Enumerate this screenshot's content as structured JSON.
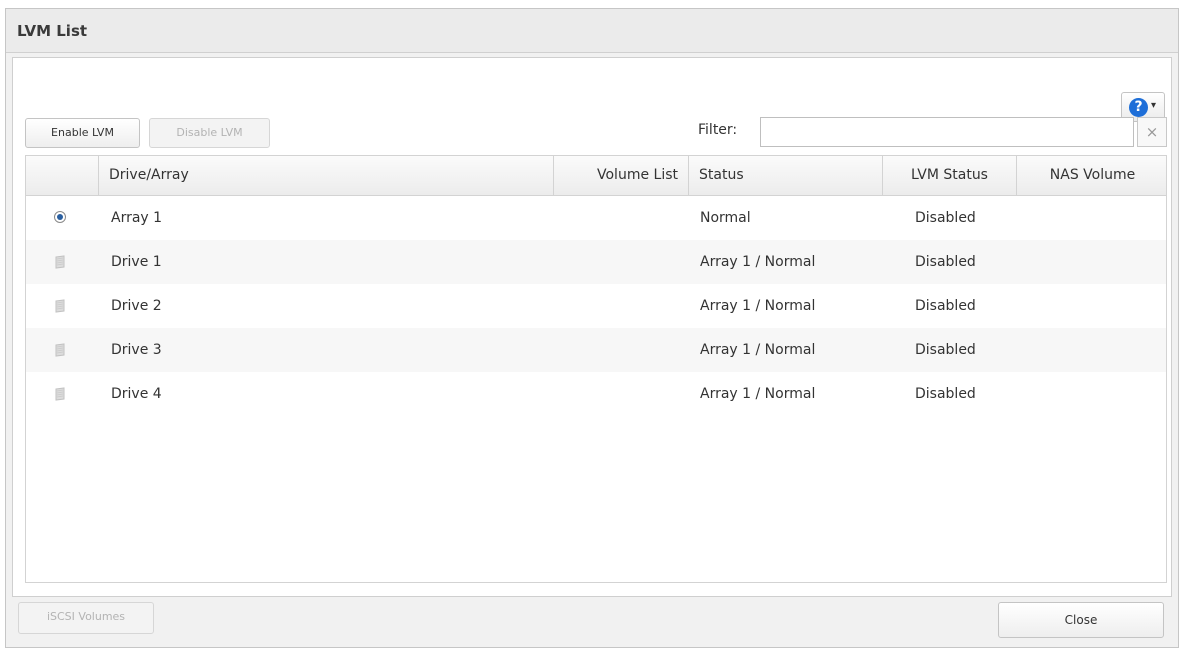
{
  "dialog": {
    "title": "LVM List"
  },
  "toolbar": {
    "enable_lvm_label": "Enable LVM",
    "disable_lvm_label": "Disable LVM",
    "help_symbol": "?",
    "help_caret": "▾",
    "help_icon": "help-circle-icon"
  },
  "filter": {
    "label": "Filter:",
    "value": "",
    "placeholder": "",
    "clear_symbol": "×"
  },
  "table": {
    "columns": [
      "",
      "Drive/Array",
      "Volume List",
      "Status",
      "LVM Status",
      "NAS Volume"
    ],
    "rows": [
      {
        "type": "array",
        "selected": true,
        "name": "Array 1",
        "volume_list": "",
        "status": "Normal",
        "lvm_status": "Disabled",
        "nas_volume": ""
      },
      {
        "type": "drive",
        "selected": false,
        "name": "Drive 1",
        "volume_list": "",
        "status": "Array 1 / Normal",
        "lvm_status": "Disabled",
        "nas_volume": ""
      },
      {
        "type": "drive",
        "selected": false,
        "name": "Drive 2",
        "volume_list": "",
        "status": "Array 1 / Normal",
        "lvm_status": "Disabled",
        "nas_volume": ""
      },
      {
        "type": "drive",
        "selected": false,
        "name": "Drive 3",
        "volume_list": "",
        "status": "Array 1 / Normal",
        "lvm_status": "Disabled",
        "nas_volume": ""
      },
      {
        "type": "drive",
        "selected": false,
        "name": "Drive 4",
        "volume_list": "",
        "status": "Array 1 / Normal",
        "lvm_status": "Disabled",
        "nas_volume": ""
      }
    ]
  },
  "footer": {
    "iscsi_volumes_label": "iSCSI Volumes",
    "close_label": "Close"
  },
  "colors": {
    "help_icon": "#1d6ed8",
    "radio_dot": "#2a5fa0",
    "disabled_text": "#b3b3b3"
  }
}
